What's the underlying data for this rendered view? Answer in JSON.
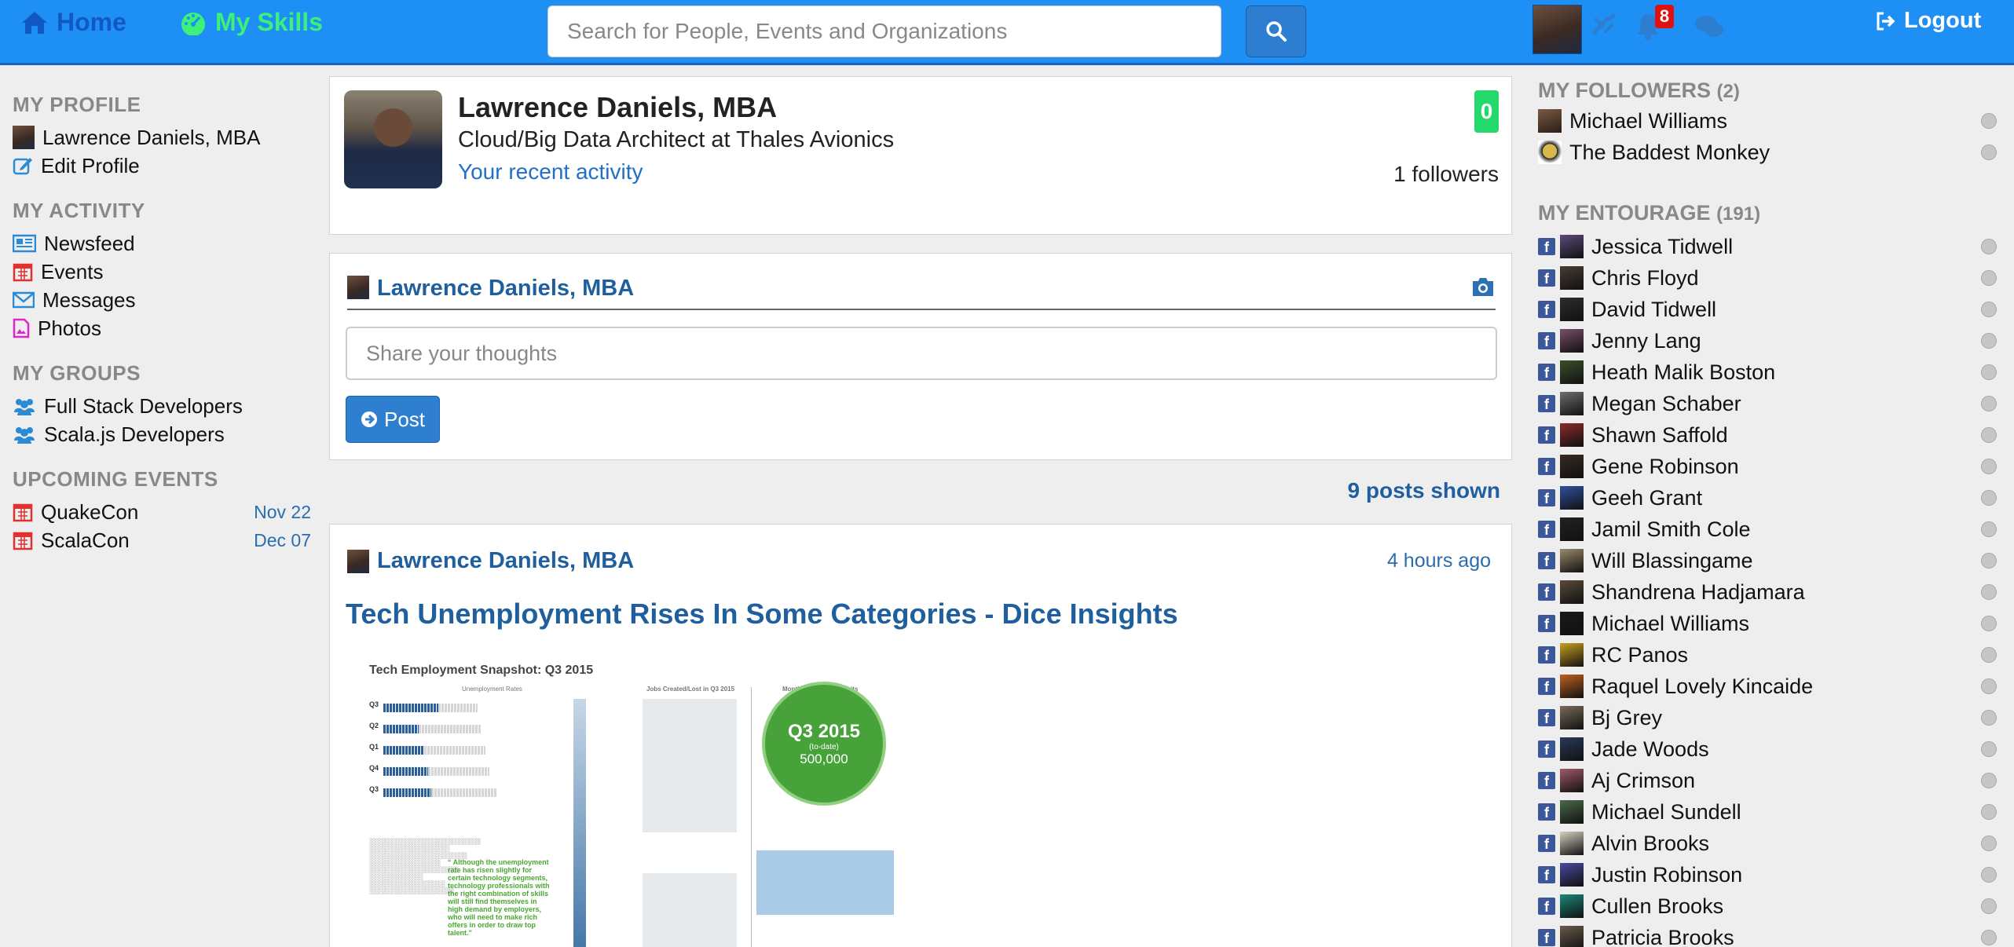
{
  "nav": {
    "home_label": "Home",
    "skills_label": "My Skills",
    "search_placeholder": "Search for People, Events and Organizations",
    "notification_count": "8",
    "logout_label": "Logout"
  },
  "left": {
    "profile_title": "MY PROFILE",
    "profile_name": "Lawrence Daniels, MBA",
    "edit_profile": "Edit Profile",
    "activity_title": "MY ACTIVITY",
    "activity_items": [
      "Newsfeed",
      "Events",
      "Messages",
      "Photos"
    ],
    "groups_title": "MY GROUPS",
    "groups": [
      "Full Stack Developers",
      "Scala.js Developers"
    ],
    "events_title": "UPCOMING EVENTS",
    "events": [
      {
        "name": "QuakeCon",
        "date": "Nov 22"
      },
      {
        "name": "ScalaCon",
        "date": "Dec 07"
      }
    ]
  },
  "profile": {
    "name": "Lawrence Daniels, MBA",
    "headline": "Cloud/Big Data Architect at Thales Avionics",
    "recent_activity": "Your recent activity",
    "score": "0",
    "followers": "1 followers"
  },
  "composer": {
    "author": "Lawrence Daniels, MBA",
    "placeholder": "Share your thoughts",
    "post_label": "Post"
  },
  "feed": {
    "posts_shown": "9 posts shown",
    "post": {
      "author": "Lawrence Daniels, MBA",
      "time": "4 hours ago",
      "title": "Tech Unemployment Rises In Some Categories - Dice Insights",
      "image": {
        "heading": "Tech Employment Snapshot: Q3 2015",
        "unemployment_caption": "Unemployment Rates",
        "jobs_caption": "Jobs Created/Lost in Q3 2015",
        "quits_caption": "Monthly Average of Quits",
        "circle_label": "Q3 2015",
        "circle_sub": "(to-date)",
        "circle_value": "500,000",
        "rows": [
          {
            "q": "Q3",
            "tech": "3.0%",
            "nat": "5.2%"
          },
          {
            "q": "Q2",
            "tech": "2.0%",
            "nat": "5.4%"
          },
          {
            "q": "Q1",
            "tech": "2.3%",
            "nat": "5.6%"
          },
          {
            "q": "Q4",
            "tech": "2.5%",
            "nat": "5.7%"
          },
          {
            "q": "Q3",
            "tech": "2.7%",
            "nat": "6.1%"
          }
        ],
        "quote": "“ Although the unemployment rate has risen slightly for certain technology segments, technology professionals with the right combination of skills will still find themselves in high demand by employers, who will need to make rich offers in order to draw top talent.”"
      }
    }
  },
  "right": {
    "followers_title": "MY FOLLOWERS",
    "followers_count": "(2)",
    "followers": [
      "Michael Williams",
      "The Baddest Monkey"
    ],
    "entourage_title": "MY ENTOURAGE",
    "entourage_count": "(191)",
    "entourage": [
      "Jessica Tidwell",
      "Chris Floyd",
      "David Tidwell",
      "Jenny Lang",
      "Heath Malik Boston",
      "Megan Schaber",
      "Shawn Saffold",
      "Gene Robinson",
      "Geeh Grant",
      "Jamil Smith Cole",
      "Will Blassingame",
      "Shandrena Hadjamara",
      "Michael Williams",
      "RC Panos",
      "Raquel Lovely Kincaide",
      "Bj Grey",
      "Jade Woods",
      "Aj Crimson",
      "Michael Sundell",
      "Alvin Brooks",
      "Justin Robinson",
      "Cullen Brooks",
      "Patricia Brooks"
    ]
  },
  "colors": {
    "topbar": "#1e90f5",
    "link": "#1f5f9e",
    "skills": "#3cf07a",
    "score": "#23d96b"
  }
}
